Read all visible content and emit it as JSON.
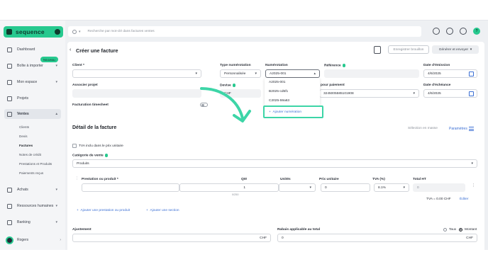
{
  "app": {
    "brand": "sequence"
  },
  "search": {
    "placeholder": "Recherche par mot-clé dans factures ventes"
  },
  "sidebar": {
    "items": [
      {
        "label": "Dashboard"
      },
      {
        "label": "Boîte à importer",
        "badge": "Nouveau"
      },
      {
        "label": "Mon espace"
      },
      {
        "label": "Projets"
      },
      {
        "label": "Ventes"
      },
      {
        "label": "Achats"
      },
      {
        "label": "Ressources humaines"
      },
      {
        "label": "Banking"
      }
    ],
    "sub_items": [
      "Clients",
      "Devis",
      "Factures",
      "Notes de crédit",
      "Prestations et Produits",
      "Paiements reçus"
    ],
    "user": "Rogers"
  },
  "header": {
    "title": "Créer une facture",
    "draft_button": "Enregistrer brouillon",
    "send_button": "Générer et envoyer"
  },
  "form": {
    "client_label": "Client *",
    "project_label": "Associer projet",
    "timesheet_label": "Facturation timesheet",
    "type_label": "Type numérotation",
    "type_value": "Personnalisée",
    "numbering_label": "Numérotation",
    "numbering_value": "A2025-001",
    "reference_label": "Référence",
    "emission_label": "Date d'émission",
    "emission_value": "4/6/2025",
    "currency_label": "Devise",
    "currency_value": "CHF",
    "payment_label": "pour paiement",
    "payment_value": "3245005585101908",
    "due_label": "Date d'échéance",
    "due_value": "4/6/2025"
  },
  "dropdown": {
    "options": [
      "A2025-001",
      "B2025-cd5f1",
      "C2025-59a63"
    ],
    "add_label": "Ajouter numération"
  },
  "detail": {
    "title": "Détail de la facture",
    "mass_select": "Sélection en masse",
    "settings": "Paramètres",
    "vat_included": "TVA inclu dans le prix unitaire",
    "category_label": "Catégorie de vente",
    "category_value": "Produits",
    "columns": [
      "Prestation ou produit *",
      "Qté",
      "Unités",
      "Prix unitaire",
      "TVA (%)",
      "Total HT"
    ],
    "row": {
      "qty": "1",
      "qty_hint": "0/250",
      "price": "0",
      "vat": "8.1%",
      "total": "0"
    },
    "vat_total": "TVA = 0.00 CHF",
    "edit": "Éditer",
    "add_item": "Ajouter une prestation ou produit",
    "add_section": "Ajouter une section"
  },
  "totals": {
    "adjust_label": "Ajustement",
    "adjust_currency": "CHF",
    "discount_label": "Rabais applicable au total",
    "discount_value": "0",
    "discount_currency": "CHF",
    "rate_label": "Taux",
    "amount_label": "Montant"
  },
  "colors": {
    "accent": "#27c98f",
    "link": "#3b6fd4",
    "highlight": "#3dd5a7"
  }
}
